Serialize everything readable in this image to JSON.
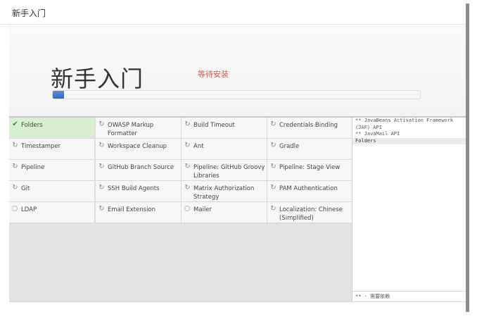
{
  "window": {
    "title": "新手入门"
  },
  "hero": {
    "heading": "新手入门",
    "status": "等待安装",
    "progress_fraction": 0.03
  },
  "plugins": [
    {
      "name": "Folders",
      "state": "done",
      "icon": "check-icon"
    },
    {
      "name": "OWASP Markup Formatter",
      "state": "installing",
      "icon": "refresh-icon"
    },
    {
      "name": "Build Timeout",
      "state": "installing",
      "icon": "refresh-icon"
    },
    {
      "name": "Credentials Binding",
      "state": "installing",
      "icon": "refresh-icon"
    },
    {
      "name": "Timestamper",
      "state": "installing",
      "icon": "refresh-icon"
    },
    {
      "name": "Workspace Cleanup",
      "state": "installing",
      "icon": "refresh-icon"
    },
    {
      "name": "Ant",
      "state": "installing",
      "icon": "refresh-icon"
    },
    {
      "name": "Gradle",
      "state": "installing",
      "icon": "refresh-icon"
    },
    {
      "name": "Pipeline",
      "state": "installing",
      "icon": "refresh-icon"
    },
    {
      "name": "GitHub Branch Source",
      "state": "installing",
      "icon": "refresh-icon"
    },
    {
      "name": "Pipeline: GitHub Groovy Libraries",
      "state": "installing",
      "icon": "refresh-icon"
    },
    {
      "name": "Pipeline: Stage View",
      "state": "installing",
      "icon": "refresh-icon"
    },
    {
      "name": "Git",
      "state": "installing",
      "icon": "refresh-icon"
    },
    {
      "name": "SSH Build Agents",
      "state": "installing",
      "icon": "refresh-icon"
    },
    {
      "name": "Matrix Authorization Strategy",
      "state": "installing",
      "icon": "refresh-icon"
    },
    {
      "name": "PAM Authentication",
      "state": "installing",
      "icon": "refresh-icon"
    },
    {
      "name": "LDAP",
      "state": "pending",
      "icon": "pending-circle-icon"
    },
    {
      "name": "Email Extension",
      "state": "installing",
      "icon": "refresh-icon"
    },
    {
      "name": "Mailer",
      "state": "pending",
      "icon": "pending-circle-icon"
    },
    {
      "name": "Localization: Chinese (Simplified)",
      "state": "installing",
      "icon": "refresh-icon"
    }
  ],
  "log": {
    "lines": [
      "** JavaBeans Activation Framework (JAF) API",
      "** JavaMail API",
      "Folders"
    ],
    "footer": "** - 需要依赖"
  }
}
